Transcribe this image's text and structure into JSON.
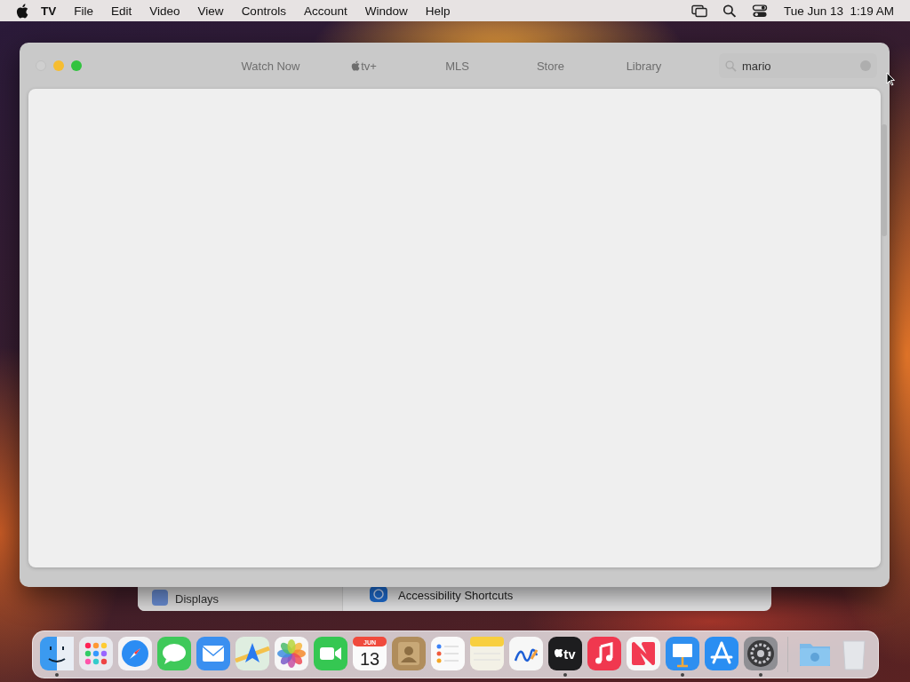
{
  "menu_bar": {
    "app": "TV",
    "items": [
      "File",
      "Edit",
      "Video",
      "View",
      "Controls",
      "Account",
      "Window",
      "Help"
    ],
    "clock": "Tue Jun 13  1:19 AM"
  },
  "background_window": {
    "sidebar_item": "Displays",
    "row": "Accessibility Shortcuts"
  },
  "tv_window": {
    "tabs": [
      {
        "label": "Watch Now",
        "selected": false
      },
      {
        "label": "tv+",
        "kind": "apple",
        "selected": false
      },
      {
        "label": "MLS",
        "selected": false
      },
      {
        "label": "Store",
        "selected": false
      },
      {
        "label": "Library",
        "selected": false
      }
    ],
    "search": {
      "value": "mario"
    }
  },
  "dock": {
    "apps": [
      {
        "kind": "finder",
        "running": true
      },
      {
        "kind": "launchpad",
        "running": false
      },
      {
        "kind": "safari",
        "running": false
      },
      {
        "kind": "messages",
        "running": false
      },
      {
        "kind": "mail",
        "running": false
      },
      {
        "kind": "maps",
        "running": false
      },
      {
        "kind": "photos",
        "running": false
      },
      {
        "kind": "facetime",
        "running": false
      },
      {
        "kind": "calendar",
        "month": "JUN",
        "day": "13",
        "running": false
      },
      {
        "kind": "contacts",
        "running": false
      },
      {
        "kind": "reminders",
        "running": false
      },
      {
        "kind": "notes",
        "running": false
      },
      {
        "kind": "freeform",
        "running": false
      },
      {
        "kind": "tv",
        "label": "tv",
        "running": true
      },
      {
        "kind": "music",
        "running": false
      },
      {
        "kind": "news",
        "running": false
      },
      {
        "kind": "keynote",
        "running": true
      },
      {
        "kind": "appstore",
        "running": false
      },
      {
        "kind": "settings",
        "running": true
      }
    ],
    "others": [
      {
        "kind": "downloads"
      },
      {
        "kind": "trash"
      }
    ]
  }
}
